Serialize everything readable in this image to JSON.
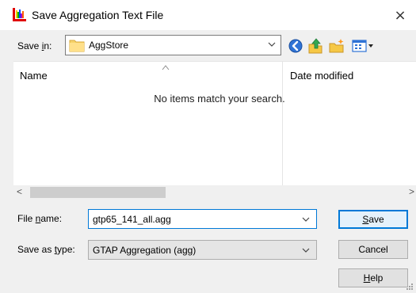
{
  "window": {
    "title": "Save Aggregation Text File",
    "close_glyph": "×",
    "icon": "rainbow-app-icon"
  },
  "toolbar": {
    "save_in_label_pre": "Save ",
    "save_in_label_key": "i",
    "save_in_label_post": "n:",
    "folder": "AggStore",
    "icons": [
      "back-arrow-icon",
      "up-folder-icon",
      "new-folder-icon",
      "view-menu-icon"
    ]
  },
  "file_list": {
    "columns": {
      "name": "Name",
      "date_modified": "Date modified"
    },
    "empty_message": "No items match your search.",
    "scroll_left": "<",
    "scroll_right": ">"
  },
  "form": {
    "file_name_label_pre": "File ",
    "file_name_label_key": "n",
    "file_name_label_post": "ame:",
    "file_name_value": "gtp65_141_all.agg",
    "save_as_type_label_pre": "Save as ",
    "save_as_type_label_key": "t",
    "save_as_type_label_post": "ype:",
    "save_as_type_value": "GTAP Aggregation (agg)"
  },
  "buttons": {
    "save_key": "S",
    "save_rest": "ave",
    "cancel": "Cancel",
    "help_key": "H",
    "help_rest": "elp"
  },
  "colors": {
    "accent": "#0078d7",
    "dialog_bg": "#f0f0f0"
  }
}
